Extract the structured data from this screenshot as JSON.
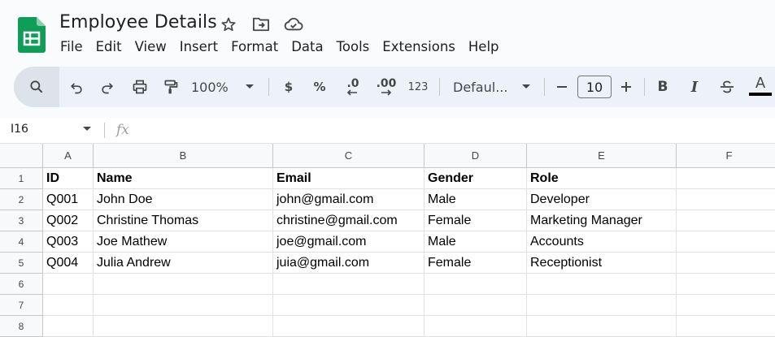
{
  "app": {
    "title": "Employee Details",
    "menu": [
      "File",
      "Edit",
      "View",
      "Insert",
      "Format",
      "Data",
      "Tools",
      "Extensions",
      "Help"
    ]
  },
  "toolbar": {
    "zoom": "100%",
    "currency": "$",
    "percent": "%",
    "decrease_decimal": ".0",
    "increase_decimal": ".00",
    "number_format": "123",
    "font": "Defaul...",
    "font_size": "10",
    "bold": "B",
    "italic": "I",
    "text_color": "A"
  },
  "formula_bar": {
    "cell_ref": "I16",
    "fx": "fx"
  },
  "sheet": {
    "columns": [
      "A",
      "B",
      "C",
      "D",
      "E",
      "F"
    ],
    "row_numbers": [
      "1",
      "2",
      "3",
      "4",
      "5",
      "6",
      "7",
      "8"
    ],
    "rows": [
      [
        "ID",
        "Name",
        "Email",
        "Gender",
        "Role",
        ""
      ],
      [
        "Q001",
        "John Doe",
        "john@gmail.com",
        "Male",
        "Developer",
        ""
      ],
      [
        "Q002",
        "Christine Thomas",
        "christine@gmail.com",
        "Female",
        "Marketing Manager",
        ""
      ],
      [
        "Q003",
        "Joe Mathew",
        "joe@gmail.com",
        "Male",
        "Accounts",
        ""
      ],
      [
        "Q004",
        "Julia Andrew",
        "juia@gmail.com",
        "Female",
        "Receptionist",
        ""
      ],
      [
        "",
        "",
        "",
        "",
        "",
        ""
      ],
      [
        "",
        "",
        "",
        "",
        "",
        ""
      ],
      [
        "",
        "",
        "",
        "",
        "",
        ""
      ]
    ]
  },
  "colors": {
    "sheets_green": "#0f9d58",
    "toolbar_bg": "#edf2fa",
    "text_color_bar": "#000000"
  }
}
